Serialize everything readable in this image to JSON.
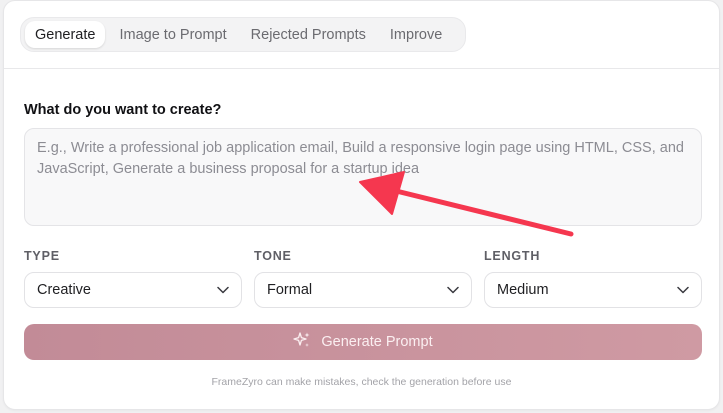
{
  "tabs": [
    {
      "label": "Generate",
      "active": true
    },
    {
      "label": "Image to Prompt",
      "active": false
    },
    {
      "label": "Rejected Prompts",
      "active": false
    },
    {
      "label": "Improve",
      "active": false
    }
  ],
  "form": {
    "question": "What do you want to create?",
    "prompt_placeholder": "E.g., Write a professional job application email, Build a responsive login page using HTML, CSS, and JavaScript, Generate a business proposal for a startup idea",
    "prompt_value": ""
  },
  "selects": {
    "type": {
      "label": "TYPE",
      "value": "Creative",
      "icon": "chevron-down-icon"
    },
    "tone": {
      "label": "TONE",
      "value": "Formal",
      "icon": "chevron-down-icon"
    },
    "length": {
      "label": "LENGTH",
      "value": "Medium",
      "icon": "chevron-down-icon"
    }
  },
  "generate_button": {
    "label": "Generate Prompt",
    "icon": "sparkles-icon"
  },
  "footer": {
    "disclaimer": "FrameZyro can make mistakes, check the generation before use"
  },
  "colors": {
    "annotation_arrow": "#f5374f",
    "button_gradient_start": "#c28b97",
    "button_gradient_end": "#cf9aa3"
  }
}
